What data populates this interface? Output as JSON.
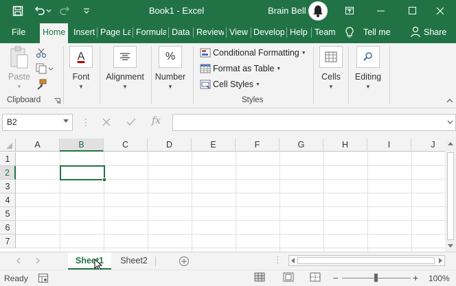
{
  "window": {
    "title": "Book1  -  Excel",
    "user": "Brain Bell"
  },
  "tabs": [
    {
      "label": "File"
    },
    {
      "label": "Home"
    },
    {
      "label": "Insert"
    },
    {
      "label": "Page Layout"
    },
    {
      "label": "Formulas"
    },
    {
      "label": "Data"
    },
    {
      "label": "Review"
    },
    {
      "label": "View"
    },
    {
      "label": "Developer"
    },
    {
      "label": "Help"
    },
    {
      "label": "Team"
    },
    {
      "label": "Tell me"
    },
    {
      "label": "Share"
    }
  ],
  "ribbon": {
    "clipboard": {
      "paste": "Paste",
      "group": "Clipboard"
    },
    "font": {
      "label": "Font",
      "icon_glyph": "A"
    },
    "alignment": {
      "label": "Alignment"
    },
    "number": {
      "label": "Number",
      "icon_glyph": "%"
    },
    "styles": {
      "items": [
        "Conditional Formatting",
        "Format as Table",
        "Cell Styles"
      ],
      "group": "Styles"
    },
    "cells": {
      "label": "Cells"
    },
    "editing": {
      "label": "Editing"
    }
  },
  "formula_bar": {
    "name_box": "B2",
    "fx": "fx",
    "formula": ""
  },
  "grid": {
    "columns": [
      "A",
      "B",
      "C",
      "D",
      "E",
      "F",
      "G",
      "H",
      "I",
      "J"
    ],
    "rows": [
      "1",
      "2",
      "3",
      "4",
      "5",
      "6",
      "7"
    ],
    "active_cell": "B2"
  },
  "sheets": [
    {
      "name": "Sheet1",
      "active": true
    },
    {
      "name": "Sheet2",
      "active": false
    }
  ],
  "status": {
    "ready": "Ready",
    "zoom": "100%"
  },
  "colors": {
    "brand": "#217346",
    "ribbon_bg": "#f3f3f3"
  }
}
